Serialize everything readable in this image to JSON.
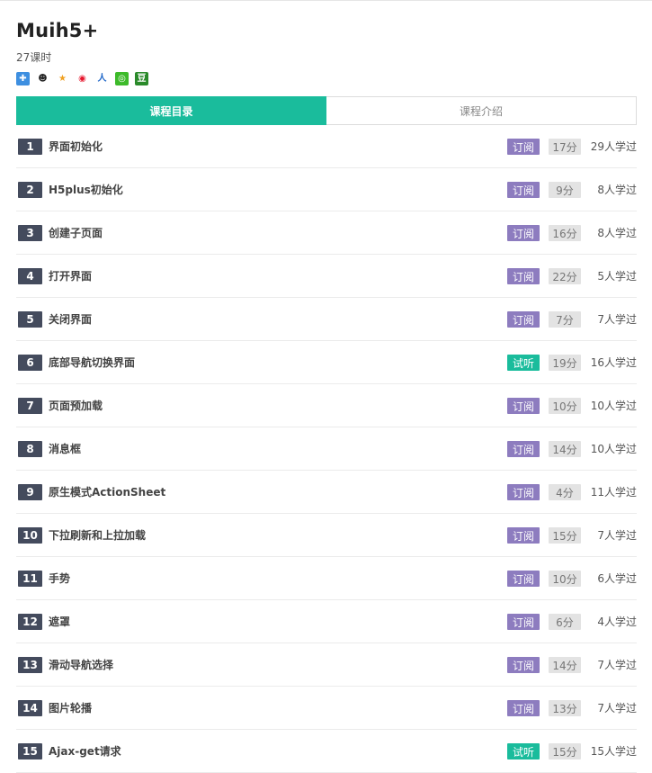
{
  "course": {
    "title": "Muih5+",
    "lessons_count": "27课时"
  },
  "share_icons": [
    {
      "name": "qzone-share-icon",
      "glyph": "✚",
      "bg": "#3d8fe0",
      "fg": "#ffffff"
    },
    {
      "name": "qq-share-icon",
      "glyph": "☻",
      "bg": "#ffffff",
      "fg": "#222222"
    },
    {
      "name": "favorite-share-icon",
      "glyph": "★",
      "bg": "#ffffff",
      "fg": "#f0a020"
    },
    {
      "name": "weibo-share-icon",
      "glyph": "◉",
      "bg": "#ffffff",
      "fg": "#e6162d"
    },
    {
      "name": "renren-share-icon",
      "glyph": "人",
      "bg": "#ffffff",
      "fg": "#1e66c8"
    },
    {
      "name": "wechat-share-icon",
      "glyph": "◎",
      "bg": "#3dba2a",
      "fg": "#ffffff"
    },
    {
      "name": "douban-share-icon",
      "glyph": "豆",
      "bg": "#2a8a2a",
      "fg": "#ffffff"
    }
  ],
  "tabs": [
    {
      "label": "课程目录",
      "active": true
    },
    {
      "label": "课程介绍",
      "active": false
    }
  ],
  "badge_colors": {
    "订阅": "#8d7cbf",
    "试听": "#1abc9c"
  },
  "lessons": [
    {
      "num": "1",
      "name": "界面初始化",
      "badge": "订阅",
      "duration": "17分",
      "learners": "29人学过"
    },
    {
      "num": "2",
      "name": "H5plus初始化",
      "badge": "订阅",
      "duration": "9分",
      "learners": "8人学过"
    },
    {
      "num": "3",
      "name": "创建子页面",
      "badge": "订阅",
      "duration": "16分",
      "learners": "8人学过"
    },
    {
      "num": "4",
      "name": "打开界面",
      "badge": "订阅",
      "duration": "22分",
      "learners": "5人学过"
    },
    {
      "num": "5",
      "name": "关闭界面",
      "badge": "订阅",
      "duration": "7分",
      "learners": "7人学过"
    },
    {
      "num": "6",
      "name": "底部导航切换界面",
      "badge": "试听",
      "duration": "19分",
      "learners": "16人学过"
    },
    {
      "num": "7",
      "name": "页面预加载",
      "badge": "订阅",
      "duration": "10分",
      "learners": "10人学过"
    },
    {
      "num": "8",
      "name": "消息框",
      "badge": "订阅",
      "duration": "14分",
      "learners": "10人学过"
    },
    {
      "num": "9",
      "name": "原生模式ActionSheet",
      "badge": "订阅",
      "duration": "4分",
      "learners": "11人学过"
    },
    {
      "num": "10",
      "name": "下拉刷新和上拉加载",
      "badge": "订阅",
      "duration": "15分",
      "learners": "7人学过"
    },
    {
      "num": "11",
      "name": "手势",
      "badge": "订阅",
      "duration": "10分",
      "learners": "6人学过"
    },
    {
      "num": "12",
      "name": "遮罩",
      "badge": "订阅",
      "duration": "6分",
      "learners": "4人学过"
    },
    {
      "num": "13",
      "name": "滑动导航选择",
      "badge": "订阅",
      "duration": "14分",
      "learners": "7人学过"
    },
    {
      "num": "14",
      "name": "图片轮播",
      "badge": "订阅",
      "duration": "13分",
      "learners": "7人学过"
    },
    {
      "num": "15",
      "name": "Ajax-get请求",
      "badge": "试听",
      "duration": "15分",
      "learners": "15人学过"
    }
  ]
}
